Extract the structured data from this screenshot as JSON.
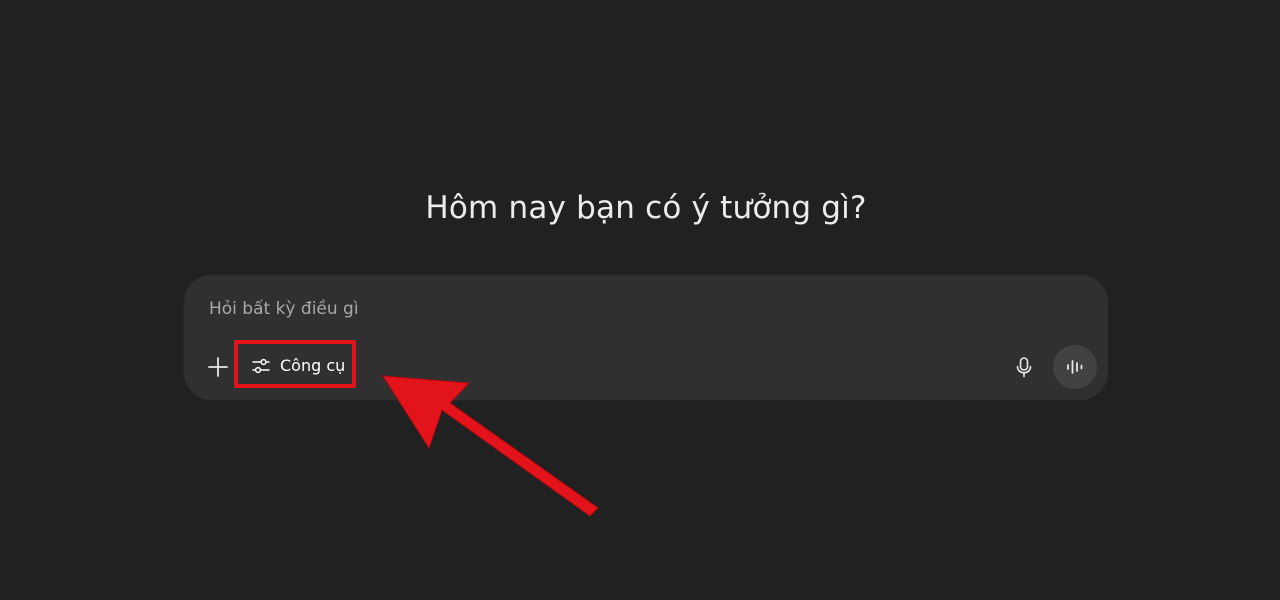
{
  "heading": "Hôm nay bạn có ý tưởng gì?",
  "composer": {
    "placeholder": "Hỏi bất kỳ điều gì",
    "value": "",
    "tools_label": "Công cụ"
  },
  "icons": {
    "add": "plus-icon",
    "tools": "sliders-icon",
    "mic": "microphone-icon",
    "voice": "voice-waveform-icon"
  },
  "annotation": {
    "highlight_color": "#e3131b",
    "arrow_color": "#e3131b"
  },
  "colors": {
    "background": "#212121",
    "composer": "#303030",
    "text": "#ececec"
  }
}
